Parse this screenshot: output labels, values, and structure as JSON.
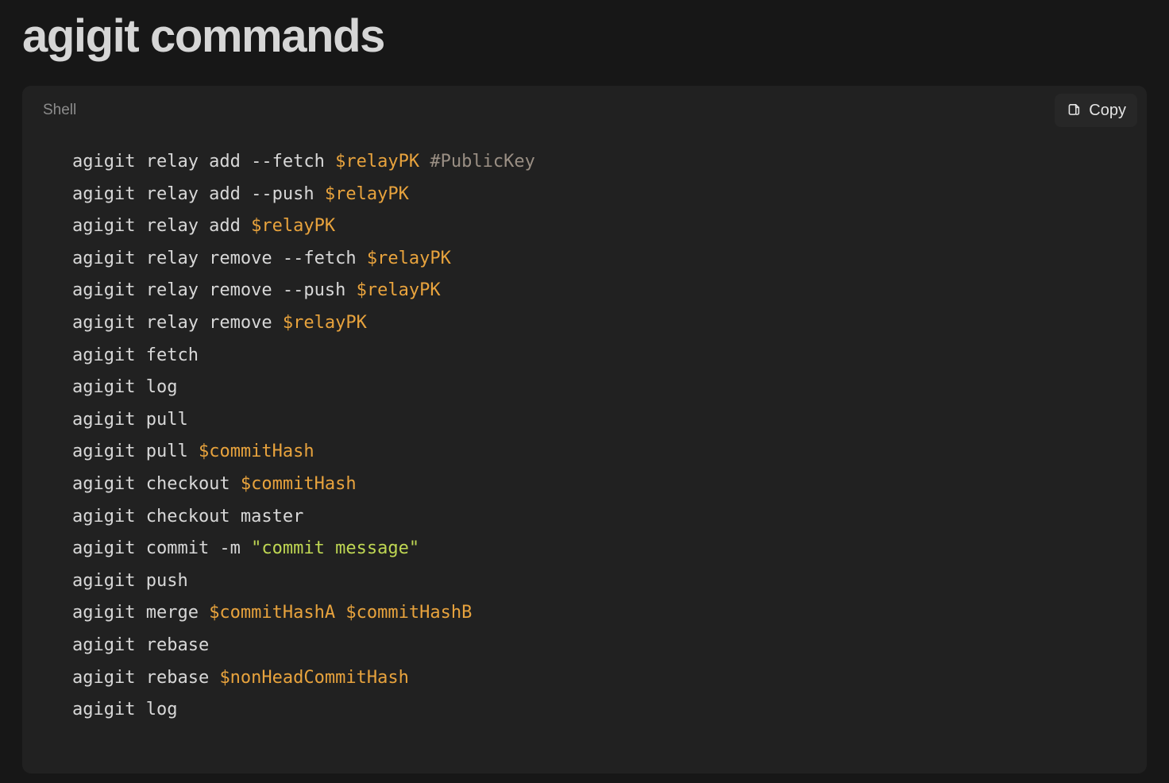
{
  "page": {
    "title": "agigit commands",
    "background_color": "#171717"
  },
  "code_card": {
    "language_label": "Shell",
    "background_color": "#212121",
    "copy_button": {
      "label": "Copy",
      "icon": "copy-icon"
    },
    "syntax_colors": {
      "plain": "#d8d8d8",
      "variable": "#e8a33d",
      "string": "#bfd753",
      "comment": "#9a8f84"
    },
    "lines": [
      [
        {
          "t": "agigit relay add --fetch ",
          "c": "plain"
        },
        {
          "t": "$relayPK",
          "c": "var"
        },
        {
          "t": " ",
          "c": "plain"
        },
        {
          "t": "#PublicKey",
          "c": "cmt"
        }
      ],
      [
        {
          "t": "agigit relay add --push ",
          "c": "plain"
        },
        {
          "t": "$relayPK",
          "c": "var"
        }
      ],
      [
        {
          "t": "agigit relay add ",
          "c": "plain"
        },
        {
          "t": "$relayPK",
          "c": "var"
        }
      ],
      [
        {
          "t": "agigit relay remove --fetch ",
          "c": "plain"
        },
        {
          "t": "$relayPK",
          "c": "var"
        }
      ],
      [
        {
          "t": "agigit relay remove --push ",
          "c": "plain"
        },
        {
          "t": "$relayPK",
          "c": "var"
        }
      ],
      [
        {
          "t": "agigit relay remove ",
          "c": "plain"
        },
        {
          "t": "$relayPK",
          "c": "var"
        }
      ],
      [
        {
          "t": "agigit fetch",
          "c": "plain"
        }
      ],
      [
        {
          "t": "agigit log",
          "c": "plain"
        }
      ],
      [
        {
          "t": "agigit pull",
          "c": "plain"
        }
      ],
      [
        {
          "t": "agigit pull ",
          "c": "plain"
        },
        {
          "t": "$commitHash",
          "c": "var"
        }
      ],
      [
        {
          "t": "agigit checkout ",
          "c": "plain"
        },
        {
          "t": "$commitHash",
          "c": "var"
        }
      ],
      [
        {
          "t": "agigit checkout master",
          "c": "plain"
        }
      ],
      [
        {
          "t": "agigit commit -m ",
          "c": "plain"
        },
        {
          "t": "\"commit message\"",
          "c": "str"
        }
      ],
      [
        {
          "t": "agigit push",
          "c": "plain"
        }
      ],
      [
        {
          "t": "agigit merge ",
          "c": "plain"
        },
        {
          "t": "$commitHashA",
          "c": "var"
        },
        {
          "t": " ",
          "c": "plain"
        },
        {
          "t": "$commitHashB",
          "c": "var"
        }
      ],
      [
        {
          "t": "agigit rebase",
          "c": "plain"
        }
      ],
      [
        {
          "t": "agigit rebase ",
          "c": "plain"
        },
        {
          "t": "$nonHeadCommitHash",
          "c": "var"
        }
      ],
      [
        {
          "t": "agigit log",
          "c": "plain"
        }
      ]
    ]
  }
}
